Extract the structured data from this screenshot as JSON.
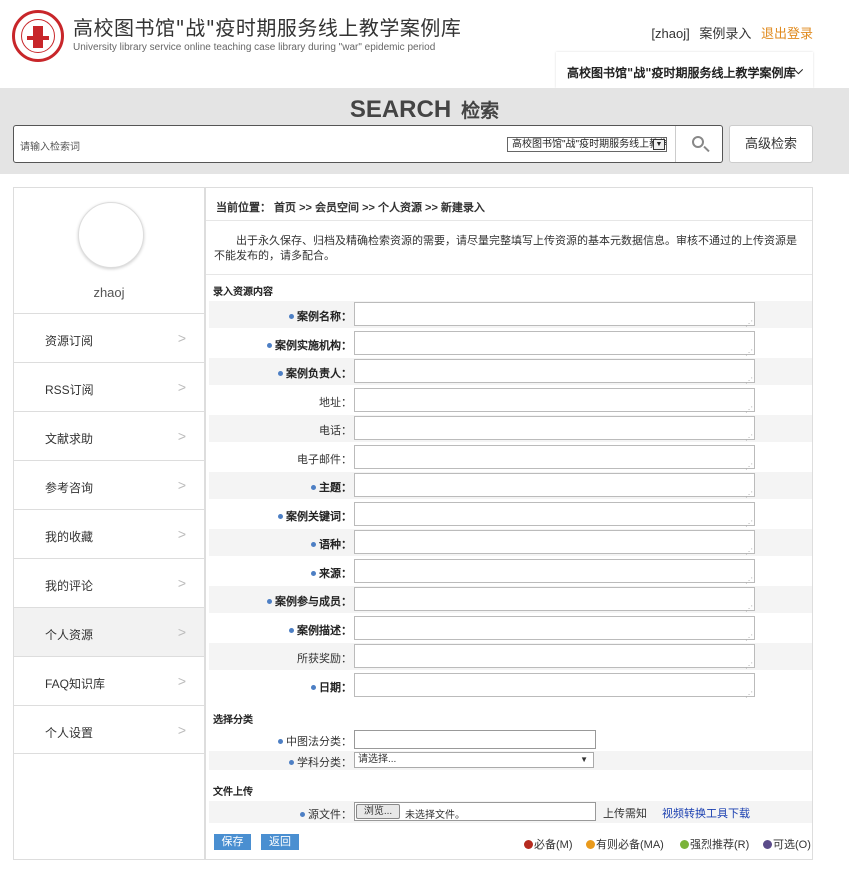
{
  "header": {
    "title": "高校图书馆\"战\"疫时期服务线上教学案例库",
    "subtitle": "University library service online teaching case library during \"war\" epidemic period",
    "username": "[zhaoj]",
    "entry_link": "案例录入",
    "logout_link": "退出登录",
    "library_select": "高校图书馆\"战\"疫时期服务线上教学案例库"
  },
  "search": {
    "title": "SEARCH",
    "title_cn": "检索",
    "placeholder": "请输入检索词",
    "scope": "高校图书馆\"战\"疫时期服务线上教学案例库",
    "advanced_label": "高级检索"
  },
  "sidebar": {
    "username": "zhaoj",
    "items": [
      {
        "label": "资源订阅"
      },
      {
        "label": "RSS订阅"
      },
      {
        "label": "文献求助"
      },
      {
        "label": "参考咨询"
      },
      {
        "label": "我的收藏"
      },
      {
        "label": "我的评论"
      },
      {
        "label": "个人资源"
      },
      {
        "label": "FAQ知识库"
      },
      {
        "label": "个人设置"
      }
    ]
  },
  "main": {
    "breadcrumb": "当前位置： 首页 >> 会员空间 >> 个人资源 >> 新建录入",
    "notice": "出于永久保存、归档及精确检索资源的需要，请尽量完整填写上传资源的基本元数据信息。审核不通过的上传资源是不能发布的，请多配合。",
    "section_input": "录入资源内容",
    "fields": [
      {
        "label": "案例名称："
      },
      {
        "label": "案例实施机构："
      },
      {
        "label": "案例负责人："
      },
      {
        "label": "地址："
      },
      {
        "label": "电话："
      },
      {
        "label": "电子邮件："
      },
      {
        "label": "主题："
      },
      {
        "label": "案例关键词："
      },
      {
        "label": "语种："
      },
      {
        "label": "来源："
      },
      {
        "label": "案例参与成员："
      },
      {
        "label": "案例描述："
      },
      {
        "label": "所获奖励："
      },
      {
        "label": "日期："
      }
    ],
    "section_category": "选择分类",
    "clc_label": "中图法分类：",
    "subject_label": "学科分类：",
    "subject_value": "请选择...",
    "section_file": "文件上传",
    "file_label": "源文件：",
    "browse_label": "浏览...",
    "file_status": "未选择文件。",
    "upload_tip": "上传需知",
    "tool_link": "视频转换工具下载",
    "save_label": "保存",
    "back_label": "返回",
    "legend": [
      {
        "label": "必备(M)",
        "color": "#b52a1f"
      },
      {
        "label": "有则必备(MA)",
        "color": "#e99a1c"
      },
      {
        "label": "强烈推荐(R)",
        "color": "#7bb33a"
      },
      {
        "label": "可选(O)",
        "color": "#5b4b8a"
      }
    ]
  },
  "colors": {
    "accent": "#4a8fd1",
    "logout": "#e08a1e",
    "link": "#1a3fb0",
    "required_dot": "#4d7fc4"
  }
}
